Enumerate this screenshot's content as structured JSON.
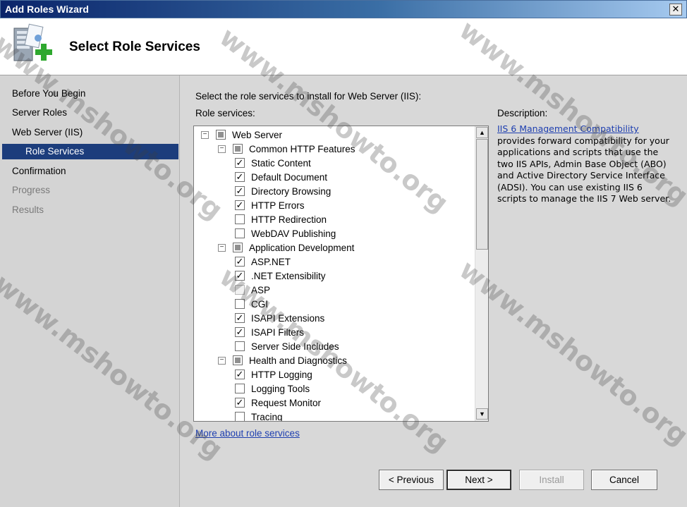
{
  "window": {
    "title": "Add Roles Wizard",
    "close_glyph": "✕"
  },
  "header": {
    "title": "Select Role Services",
    "icon": "server-add-icon"
  },
  "sidebar": {
    "items": [
      {
        "label": "Before You Begin",
        "state": "normal"
      },
      {
        "label": "Server Roles",
        "state": "normal"
      },
      {
        "label": "Web Server (IIS)",
        "state": "normal"
      },
      {
        "label": "Role Services",
        "state": "selected"
      },
      {
        "label": "Confirmation",
        "state": "normal"
      },
      {
        "label": "Progress",
        "state": "disabled"
      },
      {
        "label": "Results",
        "state": "disabled"
      }
    ]
  },
  "main": {
    "intro": "Select the role services to install for Web Server (IIS):",
    "role_services_label": "Role services:",
    "tree": [
      {
        "label": "Web Server",
        "level": 0,
        "expander": "−",
        "check": "partial"
      },
      {
        "label": "Common HTTP Features",
        "level": 1,
        "expander": "−",
        "check": "partial"
      },
      {
        "label": "Static Content",
        "level": 2,
        "check": "checked"
      },
      {
        "label": "Default Document",
        "level": 2,
        "check": "checked"
      },
      {
        "label": "Directory Browsing",
        "level": 2,
        "check": "checked"
      },
      {
        "label": "HTTP Errors",
        "level": 2,
        "check": "checked"
      },
      {
        "label": "HTTP Redirection",
        "level": 2,
        "check": "unchecked"
      },
      {
        "label": "WebDAV Publishing",
        "level": 2,
        "check": "unchecked"
      },
      {
        "label": "Application Development",
        "level": 1,
        "expander": "−",
        "check": "partial"
      },
      {
        "label": "ASP.NET",
        "level": 2,
        "check": "checked"
      },
      {
        "label": ".NET Extensibility",
        "level": 2,
        "check": "checked"
      },
      {
        "label": "ASP",
        "level": 2,
        "check": "disabled"
      },
      {
        "label": "CGI",
        "level": 2,
        "check": "unchecked"
      },
      {
        "label": "ISAPI Extensions",
        "level": 2,
        "check": "checked"
      },
      {
        "label": "ISAPI Filters",
        "level": 2,
        "check": "checked"
      },
      {
        "label": "Server Side Includes",
        "level": 2,
        "check": "unchecked"
      },
      {
        "label": "Health and Diagnostics",
        "level": 1,
        "expander": "−",
        "check": "partial"
      },
      {
        "label": "HTTP Logging",
        "level": 2,
        "check": "checked"
      },
      {
        "label": "Logging Tools",
        "level": 2,
        "check": "unchecked"
      },
      {
        "label": "Request Monitor",
        "level": 2,
        "check": "checked"
      },
      {
        "label": "Tracing",
        "level": 2,
        "check": "unchecked"
      }
    ],
    "check_glyph": "✓",
    "scroll_up": "▲",
    "scroll_down": "▼",
    "more_link": "More about role services",
    "description": {
      "label": "Description:",
      "link": "IIS 6 Management Compatibility",
      "text": "provides forward compatibility for your applications and scripts that use the two IIS APIs, Admin Base Object (ABO) and Active Directory Service Interface (ADSI). You can use existing IIS 6 scripts to manage the IIS 7 Web server."
    }
  },
  "buttons": {
    "previous": "< Previous",
    "next": "Next >",
    "install": "Install",
    "cancel": "Cancel"
  },
  "watermark": "www.mshowto.org"
}
